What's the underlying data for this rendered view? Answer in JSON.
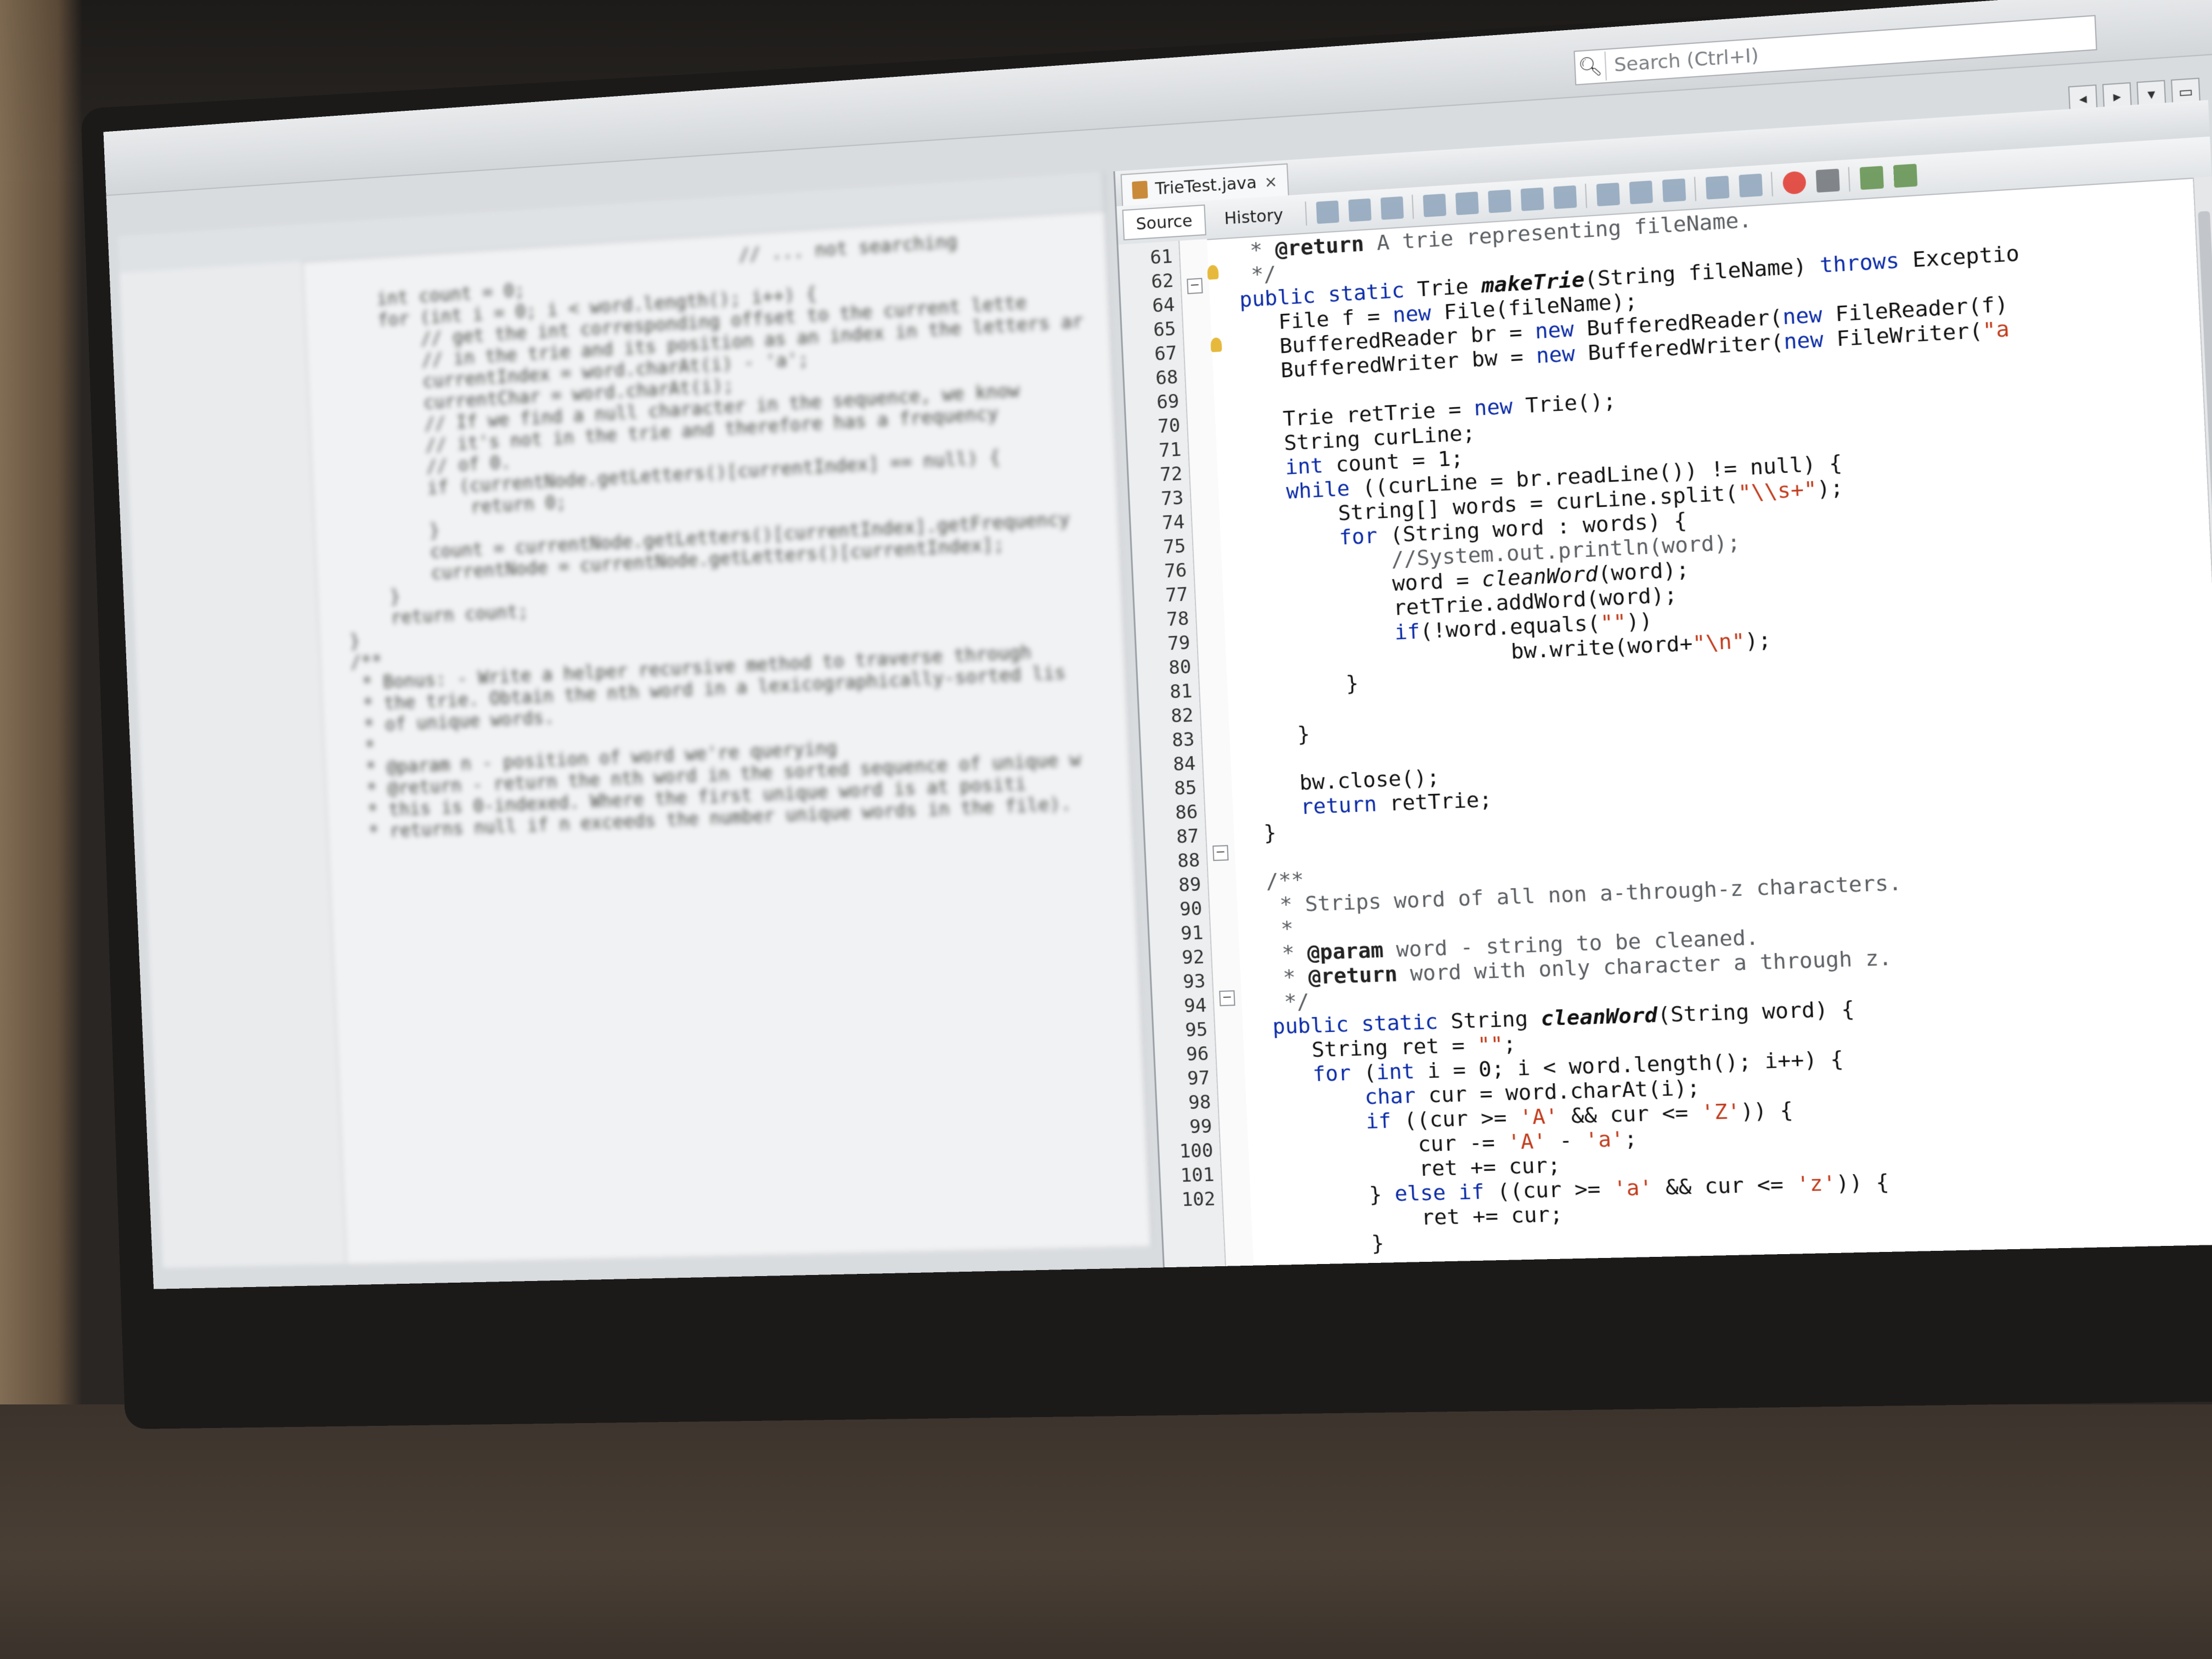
{
  "search": {
    "placeholder": "Search (Ctrl+I)"
  },
  "window_buttons": [
    "◂",
    "▸",
    "▾",
    "▭"
  ],
  "editor": {
    "tab_title": "TrieTest.java",
    "tab_close": "×",
    "view_tabs": {
      "source": "Source",
      "history": "History"
    },
    "line_numbers": [
      "61",
      "62",
      "64",
      "65",
      "67",
      "68",
      "69",
      "70",
      "71",
      "72",
      "73",
      "74",
      "75",
      "76",
      "77",
      "78",
      "79",
      "80",
      "81",
      "82",
      "83",
      "84",
      "85",
      "86",
      "87",
      "88",
      "89",
      "90",
      "91",
      "92",
      "93",
      "94",
      "95",
      "96",
      "97",
      "98",
      "99",
      "100",
      "101",
      "102"
    ],
    "code_lines": [
      "   * @return A trie representing fileName.",
      "   */",
      "  public static Trie makeTrie(String fileName) throws Exceptio",
      "     File f = new File(fileName);",
      "     BufferedReader br = new BufferedReader(new FileReader(f)",
      "     BufferedWriter bw = new BufferedWriter(new FileWriter(\"a",
      "",
      "     Trie retTrie = new Trie();",
      "     String curLine;",
      "     int count = 1;",
      "     while ((curLine = br.readLine()) != null) {",
      "         String[] words = curLine.split(\"\\\\s+\");",
      "         for (String word : words) {",
      "             //System.out.println(word);",
      "             word = cleanWord(word);",
      "             retTrie.addWord(word);",
      "             if(!word.equals(\"\"))",
      "                      bw.write(word+\"\\n\");",
      "         }",
      "",
      "     }",
      "",
      "     bw.close();",
      "     return retTrie;",
      "  }",
      "",
      "  /**",
      "   * Strips word of all non a-through-z characters.",
      "   *",
      "   * @param word - string to be cleaned.",
      "   * @return word with only character a through z.",
      "   */",
      "  public static String cleanWord(String word) {",
      "     String ret = \"\";",
      "     for (int i = 0; i < word.length(); i++) {",
      "         char cur = word.charAt(i);",
      "         if ((cur >= 'A' && cur <= 'Z')) {",
      "             cur -= 'A' - 'a';",
      "             ret += cur;",
      "         } else if ((cur >= 'a' && cur <= 'z')) {",
      "             ret += cur;",
      "         }"
    ]
  },
  "left_pane": {
    "code_lines": [
      "                                      // ... not searching",
      "",
      "    int count = 0;",
      "",
      "    for (int i = 0; i < word.length(); i++) {",
      "        // get the int corresponding offset to the current lette",
      "        // in the trie and its position as an index in the letters ar",
      "",
      "        currentIndex = word.charAt(i) - 'a';",
      "",
      "        currentChar = word.charAt(i);",
      "",
      "        // If we find a null character in the sequence, we know",
      "        // it's not in the trie and therefore has a frequency",
      "        // of 0.",
      "",
      "        if (currentNode.getLetters()[currentIndex] == null) {",
      "            return 0;",
      "        }",
      "",
      "        count = currentNode.getLetters()[currentIndex].getFrequency",
      "",
      "        currentNode = currentNode.getLetters()[currentIndex];",
      "    }",
      "",
      "    return count;",
      "}",
      "",
      "",
      "/**",
      " * Bonus: - Write a helper recursive method to traverse through",
      " * the trie. Obtain the nth word in a lexicographically-sorted lis",
      " * of unique words.",
      " *",
      " * @param n - position of word we're querying",
      " * @return - return the nth word in the sorted sequence of unique w",
      " * this is 0-indexed. Where the first unique word is at positi",
      " * returns null if n exceeds the number unique words in the file)."
    ]
  }
}
